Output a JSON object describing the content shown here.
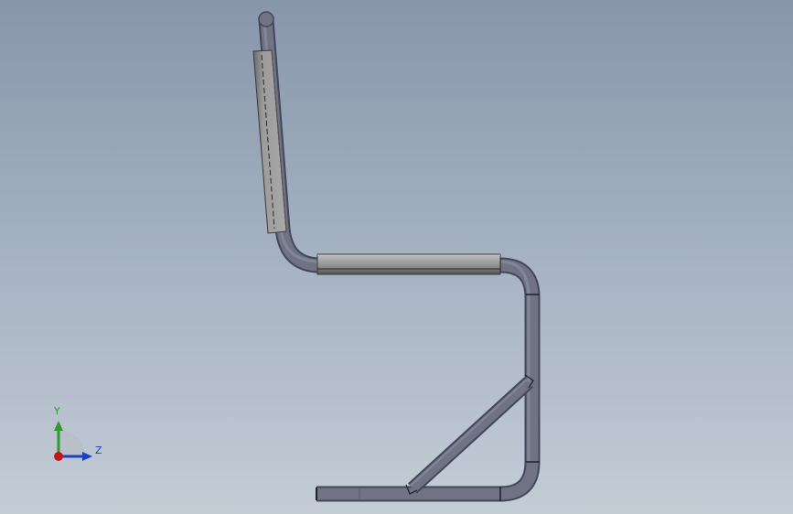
{
  "viewport": {
    "background_top": "#8796ab",
    "background_bottom": "#c4ccd6"
  },
  "model": {
    "name": "chair-frame",
    "tube_color": "#6f7383",
    "cushion_color": "#9a9a9a"
  },
  "triad": {
    "y_label": "Y",
    "z_label": "Z",
    "y_color": "#2f9a2f",
    "z_color": "#2140c0",
    "x_color": "#c01818"
  }
}
